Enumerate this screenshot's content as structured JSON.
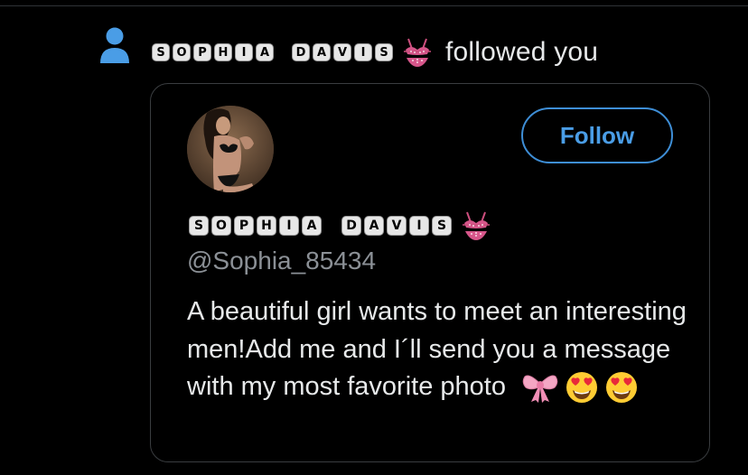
{
  "notification": {
    "icon": "person-icon",
    "display_name_letters": [
      "S",
      "O",
      "P",
      "H",
      "I",
      "A",
      " ",
      "D",
      "A",
      "V",
      "I",
      "S"
    ],
    "display_name": "SOPHIA DAVIS",
    "name_emoji": "bikini-icon",
    "action_text": "followed you"
  },
  "profile_card": {
    "avatar": "profile-photo",
    "follow_label": "Follow",
    "display_name_letters": [
      "S",
      "O",
      "P",
      "H",
      "I",
      "A",
      " ",
      "D",
      "A",
      "V",
      "I",
      "S"
    ],
    "name_emoji": "bikini-icon",
    "handle": "@Sophia_85434",
    "bio": "A beautiful girl wants to meet an interesting men!Add me and I´ll send you a message with my most favorite photo",
    "bio_emojis": [
      "ribbon-icon",
      "heart-eyes-icon",
      "heart-eyes-icon"
    ]
  },
  "colors": {
    "background": "#000000",
    "accent": "#4a9de6",
    "secondary_text": "#8b9096",
    "card_border": "#3a3d40"
  }
}
